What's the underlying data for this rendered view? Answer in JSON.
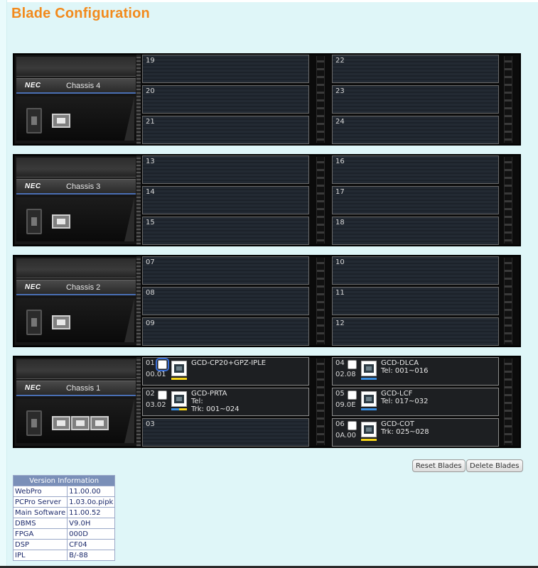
{
  "page": {
    "title": "Blade Configuration"
  },
  "brand": "NEC",
  "chassis": [
    {
      "label": "Chassis 4",
      "left_slots": [
        {
          "number": "19"
        },
        {
          "number": "20"
        },
        {
          "number": "21"
        }
      ],
      "right_slots": [
        {
          "number": "22"
        },
        {
          "number": "23"
        },
        {
          "number": "24"
        }
      ]
    },
    {
      "label": "Chassis 3",
      "left_slots": [
        {
          "number": "13"
        },
        {
          "number": "14"
        },
        {
          "number": "15"
        }
      ],
      "right_slots": [
        {
          "number": "16"
        },
        {
          "number": "17"
        },
        {
          "number": "18"
        }
      ]
    },
    {
      "label": "Chassis 2",
      "left_slots": [
        {
          "number": "07"
        },
        {
          "number": "08"
        },
        {
          "number": "09"
        }
      ],
      "right_slots": [
        {
          "number": "10"
        },
        {
          "number": "11"
        },
        {
          "number": "12"
        }
      ]
    },
    {
      "label": "Chassis 1",
      "left_slots": [
        {
          "number": "01",
          "address": "00.01",
          "name": "GCD-CP20+GPZ-IPLE",
          "line2": "",
          "line3": "",
          "bar": "yellow"
        },
        {
          "number": "02",
          "address": "03.02",
          "name": "GCD-PRTA",
          "line2": "Tel:",
          "line3": "Trk: 001~024",
          "bar": "mixed"
        },
        {
          "number": "03"
        }
      ],
      "right_slots": [
        {
          "number": "04",
          "address": "02.08",
          "name": "GCD-DLCA",
          "line2": "Tel: 001~016",
          "line3": "",
          "bar": "blue"
        },
        {
          "number": "05",
          "address": "09.0E",
          "name": "GCD-LCF",
          "line2": "Tel: 017~032",
          "line3": "",
          "bar": "blue"
        },
        {
          "number": "06",
          "address": "0A.00",
          "name": "GCD-COT",
          "line2": "Trk: 025~028",
          "line3": "",
          "bar": "yellow"
        }
      ]
    }
  ],
  "buttons": {
    "reset": "Reset Blades",
    "delete": "Delete Blades"
  },
  "version_info": {
    "header": "Version Information",
    "rows": [
      {
        "label": "WebPro",
        "value": "11.00.00"
      },
      {
        "label": "PCPro Server",
        "value": "1.03.0o.pipk"
      },
      {
        "label": "Main Software",
        "value": "11.00.52"
      },
      {
        "label": "DBMS",
        "value": "V9.0H"
      },
      {
        "label": "FPGA",
        "value": "000D"
      },
      {
        "label": "DSP",
        "value": "CF04"
      },
      {
        "label": "IPL",
        "value": "B/-88"
      }
    ]
  },
  "colors": {
    "title": "#f28a1c",
    "background": "#dff6f8",
    "bar_yellow": "#f7d61a",
    "bar_blue": "#3a8ee0"
  }
}
